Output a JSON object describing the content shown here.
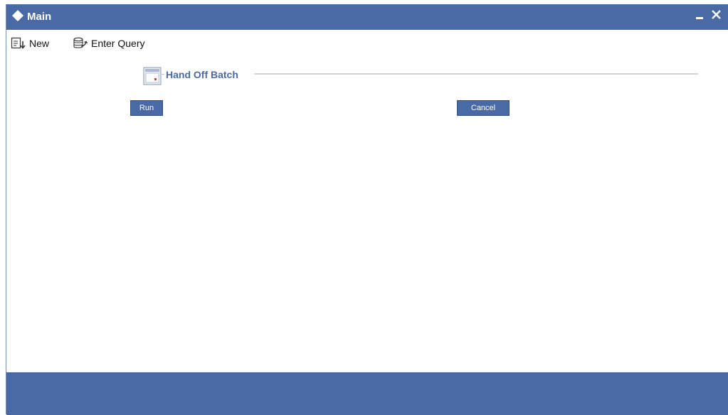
{
  "window": {
    "title": "Main",
    "minimize_icon": "minimize-icon",
    "close_icon": "close-icon"
  },
  "toolbar": {
    "new_label": "New",
    "new_icon": "new-document-icon",
    "enter_query_label": "Enter Query",
    "enter_query_icon": "database-query-icon"
  },
  "section": {
    "title": "Hand Off Batch",
    "icon": "form-window-icon"
  },
  "buttons": {
    "run_label": "Run",
    "cancel_label": "Cancel"
  },
  "colors": {
    "accent": "#4a6aa5",
    "section_text": "#4a6aa5",
    "background": "#ffffff"
  }
}
